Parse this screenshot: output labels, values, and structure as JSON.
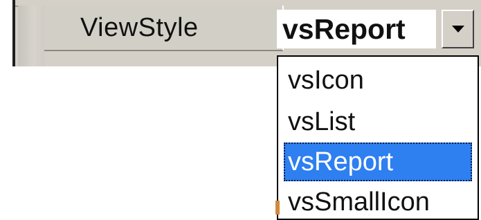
{
  "property_row": {
    "name": "ViewStyle",
    "value": "vsReport"
  },
  "dropdown": {
    "options": [
      "vsIcon",
      "vsList",
      "vsReport",
      "vsSmallIcon"
    ],
    "selected": "vsReport"
  },
  "colors": {
    "panel": "#d4d0c8",
    "selection": "#2e7ff0",
    "selection_text": "#ffffff",
    "text": "#111111"
  },
  "icons": {
    "dropdown_button": "chevron-down-icon"
  }
}
